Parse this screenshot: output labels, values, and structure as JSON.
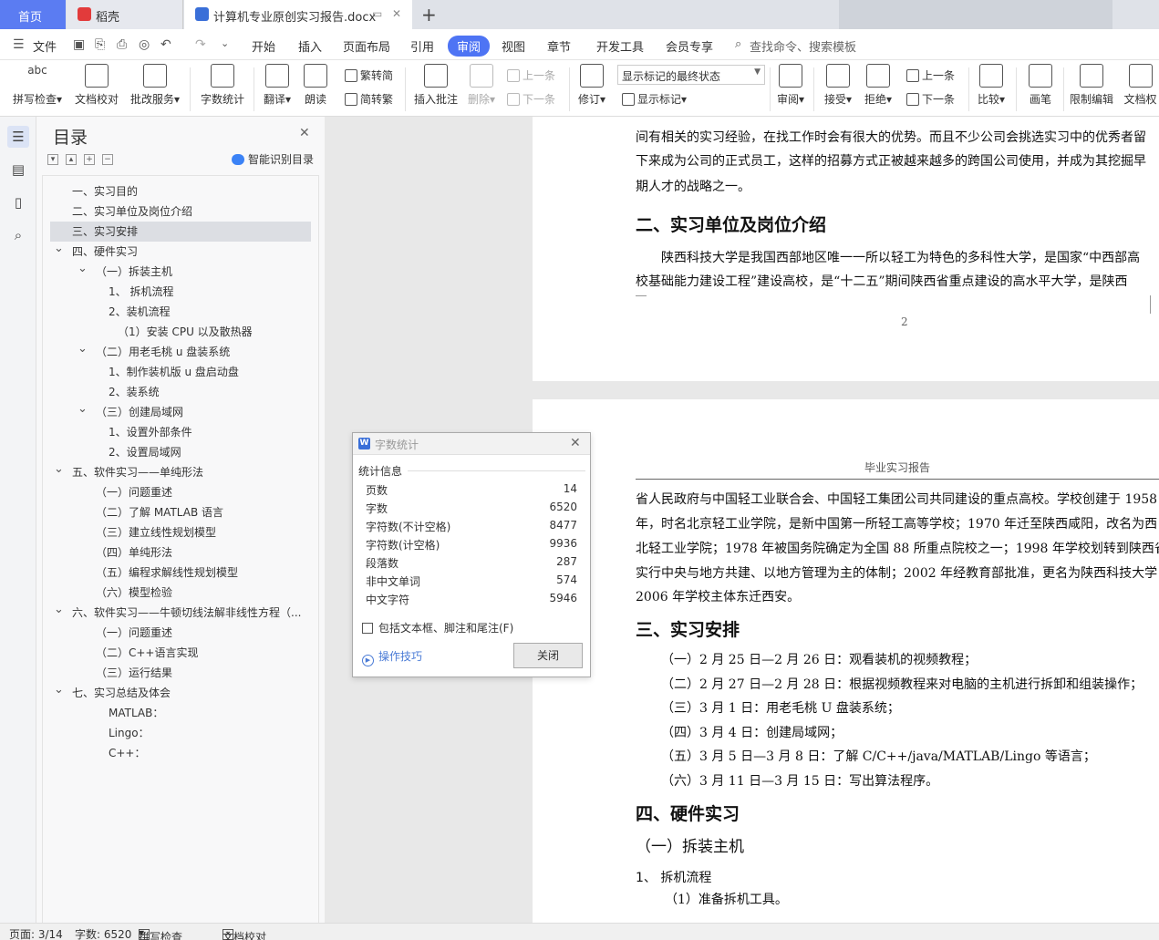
{
  "tabs": {
    "home": "首页",
    "daoke": "稻壳",
    "doc": "计算机专业原创实习报告.docx"
  },
  "menu": {
    "file": "文件",
    "items": [
      "开始",
      "插入",
      "页面布局",
      "引用",
      "审阅",
      "视图",
      "章节",
      "开发工具",
      "会员专享"
    ],
    "active": "审阅",
    "search": "查找命令、搜索模板"
  },
  "ribbon": {
    "spell": "拼写检查",
    "doccheck": "文档校对",
    "annotate_service": "批改服务",
    "wordcount": "字数统计",
    "translate": "翻译",
    "read": "朗读",
    "trad": "繁转简",
    "simp": "简转繁",
    "insert_comment": "插入批注",
    "delete": "删除",
    "prev": "上一条",
    "next": "下一条",
    "track": "修订",
    "markup_select": "显示标记的最终状态",
    "show_markup": "显示标记",
    "review": "审阅",
    "accept": "接受",
    "reject": "拒绝",
    "prev2": "上一条",
    "next2": "下一条",
    "compare": "比较",
    "pen": "画笔",
    "restrict": "限制编辑",
    "docperm": "文档权"
  },
  "toc": {
    "title": "目录",
    "smart": "智能识别目录",
    "items": [
      {
        "label": "一、实习目的",
        "level": 0,
        "chev": false
      },
      {
        "label": "二、实习单位及岗位介绍",
        "level": 0,
        "chev": false
      },
      {
        "label": "三、实习安排",
        "level": 0,
        "chev": false,
        "selected": true
      },
      {
        "label": "四、硬件实习",
        "level": 0,
        "chev": true
      },
      {
        "label": "（一）拆装主机",
        "level": 1,
        "chev": true
      },
      {
        "label": "1、  拆机流程",
        "level": 2,
        "chev": false
      },
      {
        "label": "2、装机流程",
        "level": 2,
        "chev": false
      },
      {
        "label": "（1）安装 CPU 以及散热器",
        "level": 3,
        "chev": false
      },
      {
        "label": "（二）用老毛桃 u 盘装系统",
        "level": 1,
        "chev": true
      },
      {
        "label": "1、制作装机版 u 盘启动盘",
        "level": 2,
        "chev": false
      },
      {
        "label": "2、装系统",
        "level": 2,
        "chev": false
      },
      {
        "label": "（三）创建局域网",
        "level": 1,
        "chev": true
      },
      {
        "label": "1、设置外部条件",
        "level": 2,
        "chev": false
      },
      {
        "label": "2、设置局域网",
        "level": 2,
        "chev": false
      },
      {
        "label": "五、软件实习——单纯形法",
        "level": 0,
        "chev": true
      },
      {
        "label": "（一）问题重述",
        "level": 1,
        "chev": false
      },
      {
        "label": "（二）了解 MATLAB 语言",
        "level": 1,
        "chev": false
      },
      {
        "label": "（三）建立线性规划模型",
        "level": 1,
        "chev": false
      },
      {
        "label": "（四）单纯形法",
        "level": 1,
        "chev": false
      },
      {
        "label": "（五）编程求解线性规划模型",
        "level": 1,
        "chev": false
      },
      {
        "label": "（六）模型检验",
        "level": 1,
        "chev": false
      },
      {
        "label": "六、软件实习——牛顿切线法解非线性方程（...",
        "level": 0,
        "chev": true
      },
      {
        "label": "（一）问题重述",
        "level": 1,
        "chev": false
      },
      {
        "label": "（二）C++语言实现",
        "level": 1,
        "chev": false
      },
      {
        "label": "（三）运行结果",
        "level": 1,
        "chev": false
      },
      {
        "label": "七、实习总结及体会",
        "level": 0,
        "chev": true
      },
      {
        "label": "MATLAB：",
        "level": 2,
        "chev": false
      },
      {
        "label": "Lingo：",
        "level": 2,
        "chev": false
      },
      {
        "label": "C++：",
        "level": 2,
        "chev": false
      }
    ]
  },
  "page1": {
    "lines": [
      "间有相关的实习经验，在找工作时会有很大的优势。而且不少公司会挑选实习中的优秀者留",
      "下来成为公司的正式员工，这样的招募方式正被越来越多的跨国公司使用，并成为其挖掘早",
      "期人才的战略之一。"
    ],
    "heading": "二、实习单位及岗位介绍",
    "para": [
      "陕西科技大学是我国西部地区唯一一所以轻工为特色的多科性大学，是国家“中西部高",
      "校基础能力建设工程”建设高校，是“十二五”期间陕西省重点建设的高水平大学，是陕西"
    ],
    "page_number": "2"
  },
  "page2": {
    "header": "毕业实习报告",
    "lines": [
      "省人民政府与中国轻工业联合会、中国轻工集团公司共同建设的重点高校。学校创建于 1958",
      "年，时名北京轻工业学院，是新中国第一所轻工高等学校；1970 年迁至陕西咸阳，改名为西",
      "北轻工业学院；1978 年被国务院确定为全国 88 所重点院校之一；1998 年学校划转到陕西省，",
      "实行中央与地方共建、以地方管理为主的体制；2002 年经教育部批准，更名为陕西科技大学；",
      "2006 年学校主体东迁西安。"
    ],
    "heading3": "三、实习安排",
    "schedule": [
      "（一）2 月 25 日—2 月 26 日：观看装机的视频教程；",
      "（二）2 月 27 日—2 月 28 日：根据视频教程来对电脑的主机进行拆卸和组装操作；",
      "（三）3 月 1 日：用老毛桃 U 盘装系统；",
      "（四）3 月 4 日：创建局域网；",
      "（五）3 月 5 日—3 月 8 日：了解 C/C++/java/MATLAB/Lingo 等语言；",
      "（六）3 月 11 日—3 月 15 日：写出算法程序。"
    ],
    "heading4": "四、硬件实习",
    "sub1": "（一）拆装主机",
    "sub2": "1、  拆机流程",
    "sub3": "（1）准备拆机工具。"
  },
  "dialog": {
    "title": "字数统计",
    "section": "统计信息",
    "rows": [
      {
        "k": "页数",
        "v": "14"
      },
      {
        "k": "字数",
        "v": "6520"
      },
      {
        "k": "字符数(不计空格)",
        "v": "8477"
      },
      {
        "k": "字符数(计空格)",
        "v": "9936"
      },
      {
        "k": "段落数",
        "v": "287"
      },
      {
        "k": "非中文单词",
        "v": "574"
      },
      {
        "k": "中文字符",
        "v": "5946"
      }
    ],
    "checkbox": "包括文本框、脚注和尾注(F)",
    "tips": "操作技巧",
    "close": "关闭"
  },
  "status": {
    "page": "页面: 3/14",
    "words": "字数: 6520",
    "spell": "拼写检查",
    "doccheck": "文档校对"
  },
  "colors": {
    "accent": "#4e74f4",
    "home_tab": "#5b7cf2"
  }
}
